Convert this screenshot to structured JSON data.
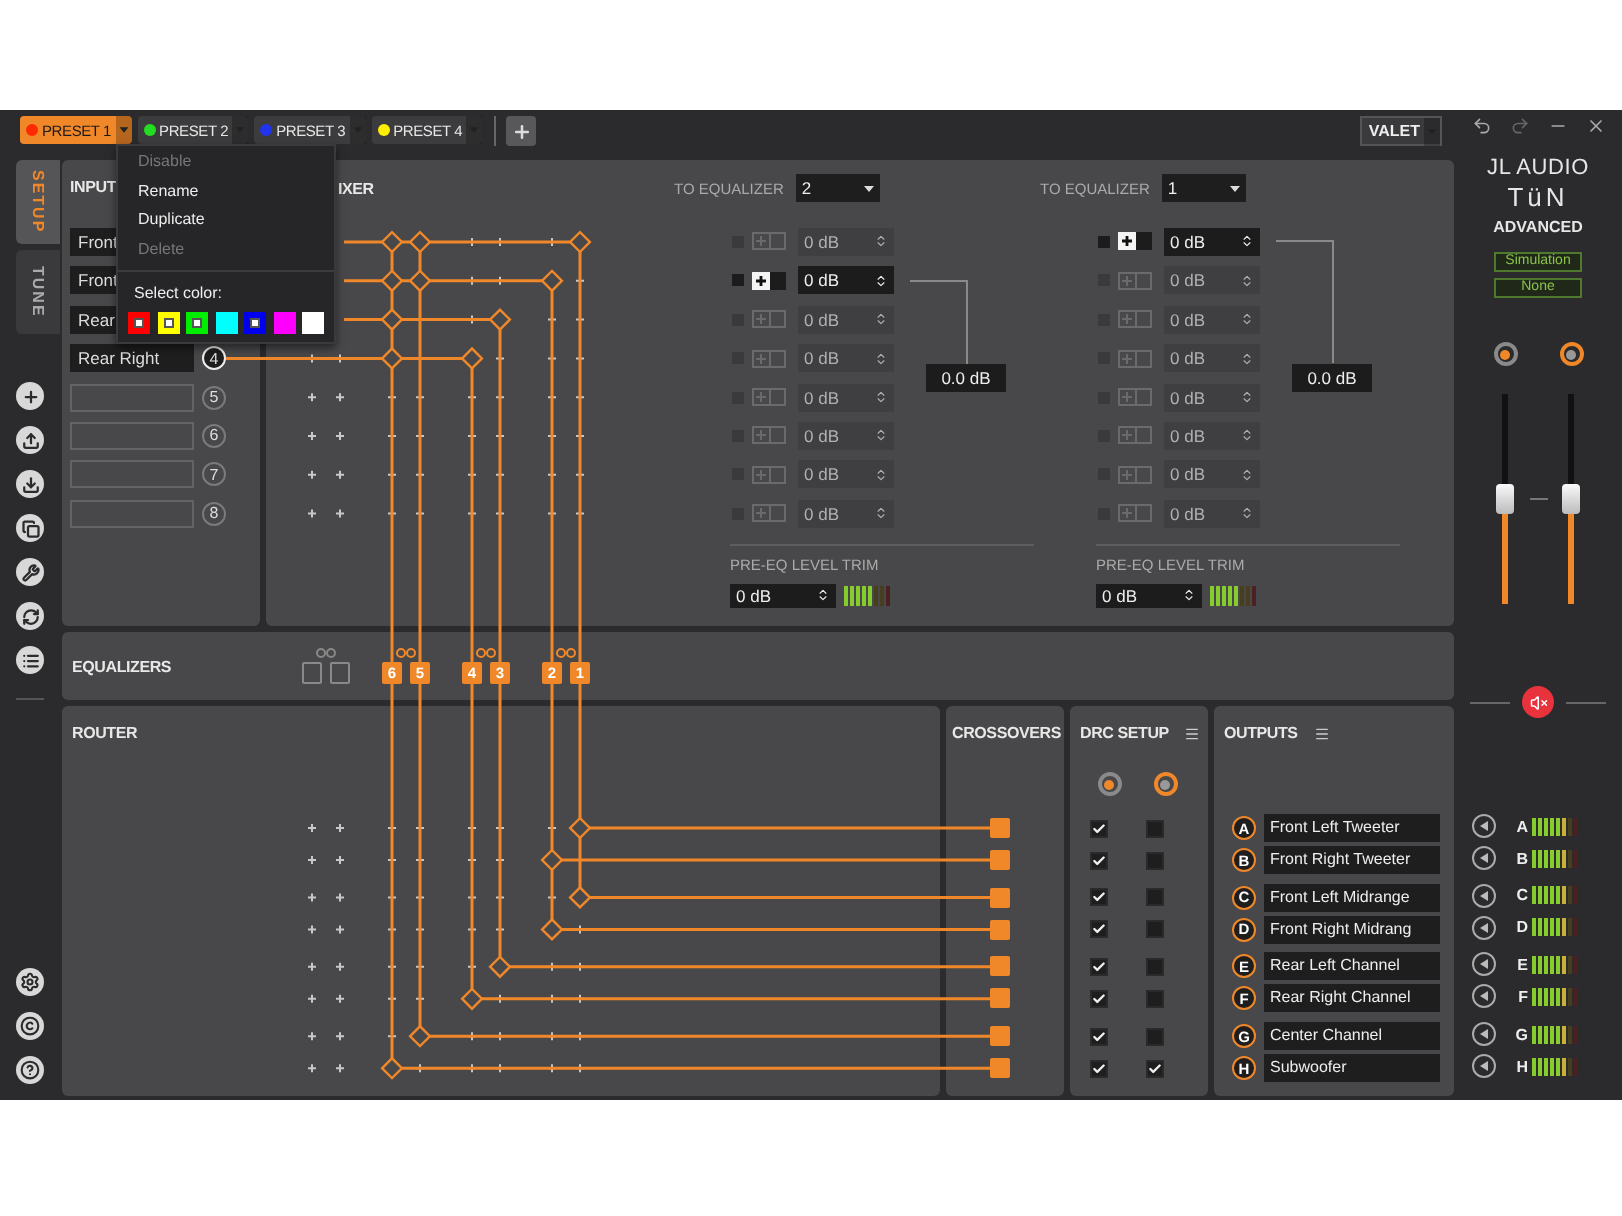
{
  "presets": [
    {
      "label": "PRESET 1",
      "color": "#ff2a00",
      "selected": true
    },
    {
      "label": "PRESET 2",
      "color": "#22dd22",
      "selected": false
    },
    {
      "label": "PRESET 3",
      "color": "#2233ee",
      "selected": false
    },
    {
      "label": "PRESET 4",
      "color": "#ffee00",
      "selected": false
    }
  ],
  "preset_menu": {
    "items": [
      {
        "label": "Disable",
        "disabled": true
      },
      {
        "label": "Rename",
        "disabled": false
      },
      {
        "label": "Duplicate",
        "disabled": false
      },
      {
        "label": "Delete",
        "disabled": true
      }
    ],
    "color_label": "Select color:",
    "swatches": [
      {
        "color": "#ff0000",
        "in_use": true
      },
      {
        "color": "#ffff00",
        "in_use": true
      },
      {
        "color": "#00ee00",
        "in_use": true
      },
      {
        "color": "#00ffff",
        "in_use": false
      },
      {
        "color": "#0000ee",
        "in_use": true
      },
      {
        "color": "#ff00ff",
        "in_use": false
      },
      {
        "color": "#ffffff",
        "in_use": false
      }
    ]
  },
  "profile": "VALET",
  "side_tabs": [
    {
      "label": "SETUP",
      "selected": true
    },
    {
      "label": "TUNE",
      "selected": false
    }
  ],
  "inputs": {
    "title": "INPUT",
    "channels": [
      {
        "name": "Front"
      },
      {
        "name": "Front"
      },
      {
        "name": "Rear"
      },
      {
        "name": "Rear Right",
        "number": "4"
      },
      {
        "number": "5"
      },
      {
        "number": "6"
      },
      {
        "number": "7"
      },
      {
        "number": "8"
      }
    ]
  },
  "mixer": {
    "title": "IXER",
    "groups": [
      {
        "label": "TO EQUALIZER",
        "target": "2",
        "channels": [
          {
            "value": "0 dB",
            "active": false
          },
          {
            "value": "0 dB",
            "active": true
          },
          {
            "value": "0 dB",
            "active": false
          },
          {
            "value": "0 dB",
            "active": false
          },
          {
            "value": "0 dB",
            "active": false
          },
          {
            "value": "0 dB",
            "active": false
          },
          {
            "value": "0 dB",
            "active": false
          },
          {
            "value": "0 dB",
            "active": false
          }
        ],
        "sum": "0.0 dB",
        "trim_label": "PRE-EQ LEVEL TRIM",
        "trim": "0 dB",
        "trim_meter": {
          "level": 0.6
        }
      },
      {
        "label": "TO EQUALIZER",
        "target": "1",
        "channels": [
          {
            "value": "0 dB",
            "active": true
          },
          {
            "value": "0 dB",
            "active": false
          },
          {
            "value": "0 dB",
            "active": false
          },
          {
            "value": "0 dB",
            "active": false
          },
          {
            "value": "0 dB",
            "active": false
          },
          {
            "value": "0 dB",
            "active": false
          },
          {
            "value": "0 dB",
            "active": false
          },
          {
            "value": "0 dB",
            "active": false
          }
        ],
        "sum": "0.0 dB",
        "trim_label": "PRE-EQ LEVEL TRIM",
        "trim": "0 dB",
        "trim_meter": {
          "level": 0.6
        }
      }
    ]
  },
  "equalizers": {
    "title": "EQUALIZERS",
    "slots": [
      {
        "assigned": false
      },
      {
        "assigned": false
      },
      {
        "label": "6",
        "assigned": true
      },
      {
        "label": "5",
        "assigned": true
      },
      {
        "label": "4",
        "assigned": true
      },
      {
        "label": "3",
        "assigned": true
      },
      {
        "label": "2",
        "assigned": true
      },
      {
        "label": "1",
        "assigned": true
      }
    ]
  },
  "router": {
    "title": "ROUTER"
  },
  "crossovers": {
    "title": "CROSSOVERS",
    "channels": [
      {
        "enabled": true
      },
      {
        "enabled": true
      },
      {
        "enabled": true
      },
      {
        "enabled": true
      },
      {
        "enabled": true
      },
      {
        "enabled": true
      },
      {
        "enabled": true
      },
      {
        "enabled": true
      }
    ]
  },
  "drc": {
    "title": "DRC SETUP",
    "selectors": [
      {
        "selected": true
      },
      {
        "selected": false
      }
    ],
    "rows": [
      {
        "checks": [
          true,
          false
        ]
      },
      {
        "checks": [
          true,
          false
        ]
      },
      {
        "checks": [
          true,
          false
        ]
      },
      {
        "checks": [
          true,
          false
        ]
      },
      {
        "checks": [
          true,
          false
        ]
      },
      {
        "checks": [
          true,
          false
        ]
      },
      {
        "checks": [
          true,
          false
        ]
      },
      {
        "checks": [
          true,
          true
        ]
      }
    ]
  },
  "outputs": {
    "title": "OUTPUTS",
    "channels": [
      {
        "letter": "A",
        "name": "Front Left Tweeter"
      },
      {
        "letter": "B",
        "name": "Front Right Tweeter"
      },
      {
        "letter": "C",
        "name": "Front Left Midrange"
      },
      {
        "letter": "D",
        "name": "Front Right Midrang"
      },
      {
        "letter": "E",
        "name": "Rear Left Channel"
      },
      {
        "letter": "F",
        "name": "Rear Right Channel"
      },
      {
        "letter": "G",
        "name": "Center Channel"
      },
      {
        "letter": "H",
        "name": "Subwoofer"
      }
    ]
  },
  "master": {
    "logo": "JL AUDIO",
    "product": "TüN",
    "edition": "ADVANCED",
    "badges": [
      "Simulation",
      "None"
    ],
    "selectors": [
      {
        "selected": true
      },
      {
        "selected": false
      }
    ],
    "faders": [
      {
        "level": 0.5
      },
      {
        "level": 0.5
      }
    ],
    "muted": true,
    "meters": [
      {
        "letter": "A",
        "level": 0.7
      },
      {
        "letter": "B",
        "level": 0.7
      },
      {
        "letter": "C",
        "level": 0.7
      },
      {
        "letter": "D",
        "level": 0.7
      },
      {
        "letter": "E",
        "level": 0.7
      },
      {
        "letter": "F",
        "level": 0.7
      },
      {
        "letter": "G",
        "level": 0.7
      },
      {
        "letter": "H",
        "level": 0.7
      }
    ]
  }
}
